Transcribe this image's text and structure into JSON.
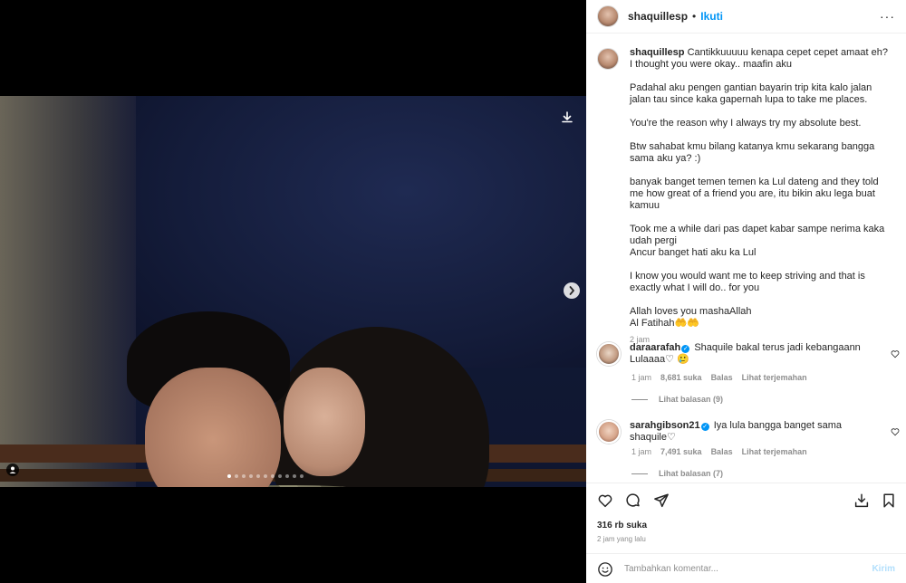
{
  "post": {
    "username": "shaquillesp",
    "follow_label": "Ikuti",
    "dot": "•",
    "more": "···",
    "caption_lines": [
      "Cantikkuuuuu kenapa cepet cepet amaat eh?",
      "I thought you were okay.. maafin aku",
      "Padahal aku pengen gantian bayarin trip kita kalo jalan jalan tau since kaka gapernah lupa to take me places.",
      "You're the reason why I always try my absolute best.",
      "Btw sahabat kmu bilang katanya kmu sekarang bangga sama aku ya? :)",
      "banyak banget temen temen ka Lul dateng and they told me how great of a friend you are, itu bikin aku lega buat kamuu",
      "Took me a while dari pas dapet kabar sampe nerima kaka udah pergi",
      "Ancur banget hati aku ka Lul",
      "I know you would want me to keep striving and that is exactly what I will do.. for you",
      "Allah loves you mashaAllah",
      "Al Fatihah🤲🤲"
    ],
    "caption_time": "2 jam",
    "likes": "316 rb suka",
    "time_ago": "2 jam yang lalu"
  },
  "comments": [
    {
      "username": "daraarafah",
      "text": "Shaquile bakal terus jadi kebangaann Lulaaaa♡ 🥲",
      "time": "1 jam",
      "likes": "8,681 suka",
      "reply": "Balas",
      "translate": "Lihat terjemahan",
      "view_replies": "Lihat balasan (9)"
    },
    {
      "username": "sarahgibson21",
      "text": "Iya lula bangga banget sama shaquile♡",
      "time": "1 jam",
      "likes": "7,491 suka",
      "reply": "Balas",
      "translate": "Lihat terjemahan",
      "view_replies": "Lihat balasan (7)"
    }
  ],
  "composer": {
    "placeholder": "Tambahkan komentar...",
    "send_label": "Kirim"
  },
  "carousel": {
    "count": 11,
    "active_index": 0
  },
  "colors": {
    "accent": "#0095f6",
    "muted": "#8e8e8e",
    "text": "#262626",
    "send_disabled": "#b2dffc"
  },
  "icons": [
    "download-icon",
    "next-arrow-icon",
    "tag-icon",
    "more-icon",
    "heart-icon",
    "comment-icon",
    "share-icon",
    "save-icon",
    "bookmark-icon",
    "emoji-icon",
    "verified-icon"
  ]
}
